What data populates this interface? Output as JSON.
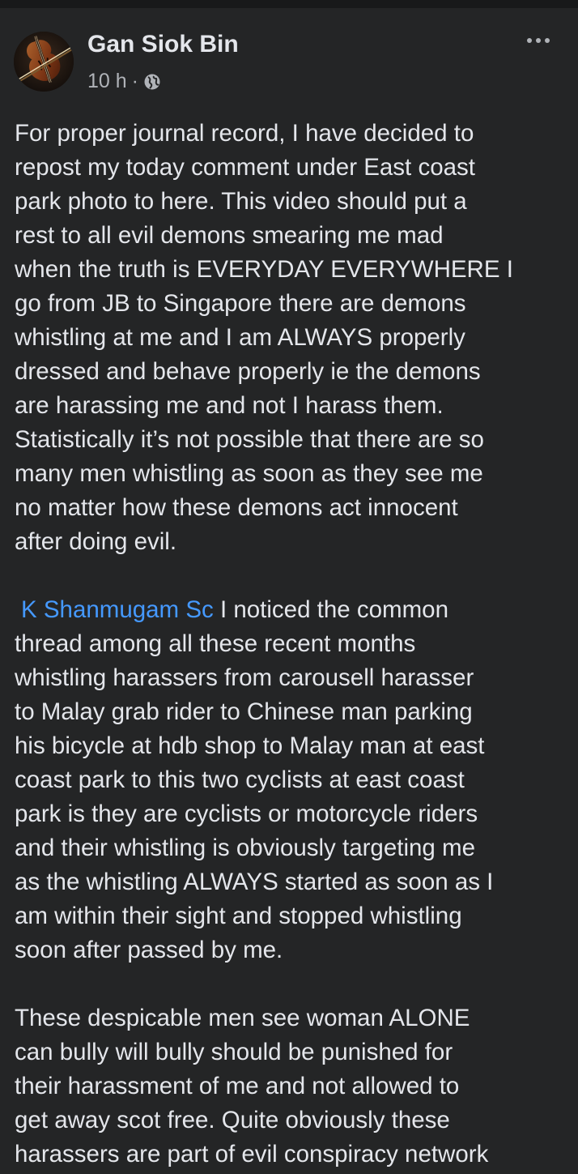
{
  "post": {
    "author": "Gan Siok Bin",
    "time": "10 h",
    "separator": "·",
    "privacy_icon": "globe-icon",
    "more_icon": "more-options-icon",
    "avatar_icon": "violin-avatar-icon",
    "mention": "K Shanmugam Sc",
    "paragraphs": [
      {
        "lines": [
          "For proper journal record, I have decided to",
          "repost my today comment under East coast",
          "park photo to here. This video should put a",
          "rest to all evil demons smearing me mad",
          "when the truth is EVERYDAY EVERYWHERE I",
          "go from JB to Singapore there are demons",
          "whistling at me and I am ALWAYS properly",
          "dressed and behave properly ie the demons",
          "are harassing me and not I harass them.",
          "Statistically it’s not possible that there are so",
          "many men whistling as soon as they see me",
          "no matter how these demons act innocent",
          "after doing evil."
        ]
      },
      {
        "first_line_rest": " I noticed the common",
        "lines": [
          "thread among all these recent months",
          "whistling harassers from carousell harasser",
          "to Malay grab rider to Chinese man parking",
          "his bicycle at hdb shop to Malay man at east",
          "coast park to this two cyclists at east coast",
          "park is they are cyclists or motorcycle riders",
          "and their whistling is obviously targeting me",
          "as the whistling ALWAYS started as soon as I",
          "am within their sight and stopped whistling",
          "soon after passed by me."
        ]
      },
      {
        "lines": [
          "These despicable men see woman ALONE",
          "can bully will bully should be punished for",
          "their harassment of me and not allowed to",
          "get away scot free. Quite obviously these",
          "harassers are part of evil conspiracy network"
        ]
      }
    ]
  },
  "colors": {
    "background": "#242526",
    "text": "#e4e6eb",
    "secondary_text": "#b0b3b8",
    "mention": "#4599ff"
  }
}
